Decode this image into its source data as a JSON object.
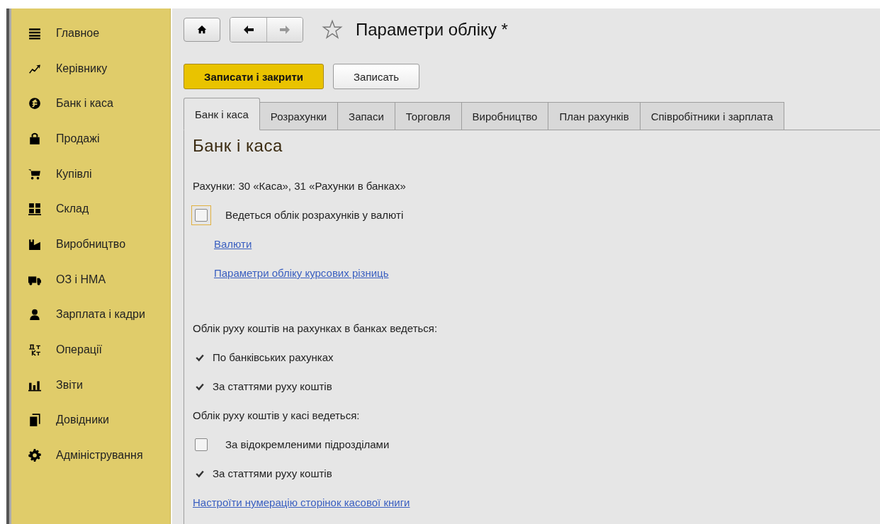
{
  "sidebar": {
    "items": [
      {
        "label": "Главное"
      },
      {
        "label": "Керівнику"
      },
      {
        "label": "Банк і каса"
      },
      {
        "label": "Продажі"
      },
      {
        "label": "Купівлі"
      },
      {
        "label": "Склад"
      },
      {
        "label": "Виробництво"
      },
      {
        "label": "ОЗ і НМА"
      },
      {
        "label": "Зарплата і кадри"
      },
      {
        "label": "Операції"
      },
      {
        "label": "Звіти"
      },
      {
        "label": "Довідники"
      },
      {
        "label": "Адміністрування"
      }
    ]
  },
  "toolbar": {
    "forward_disabled": true,
    "title": "Параметри обліку *"
  },
  "buttons": [
    {
      "label": "Записати і закрити",
      "kind": "primary"
    },
    {
      "label": "Записать",
      "kind": "default"
    }
  ],
  "tabs": [
    {
      "label": "Банк і каса",
      "selected": true
    },
    {
      "label": "Розрахунки",
      "selected": false
    },
    {
      "label": "Запаси",
      "selected": false
    },
    {
      "label": "Торговля",
      "selected": false
    },
    {
      "label": "Виробництво",
      "selected": false
    },
    {
      "label": "План рахунків",
      "selected": false
    },
    {
      "label": "Співробітники і зарплата",
      "selected": false
    }
  ],
  "section": {
    "heading": "Банк і каса",
    "rows": [
      {
        "kind": "text",
        "text": "Рахунки: 30 «Каса», 31 «Рахунки в банках»"
      },
      {
        "kind": "checkbox",
        "text": "Ведеться облік розрахунків у валюті",
        "checked": false,
        "focused": true
      },
      {
        "kind": "link",
        "text": "Валюти",
        "indent": true
      },
      {
        "kind": "link",
        "text": "Параметри обліку курсових різниць",
        "indent": true
      },
      {
        "kind": "spacer"
      },
      {
        "kind": "text",
        "text": "Облік руху коштів на рахунках в банках ведеться:"
      },
      {
        "kind": "check",
        "text": "По банківських рахунках",
        "checked": true
      },
      {
        "kind": "check",
        "text": "За статтями руху коштів",
        "checked": true
      },
      {
        "kind": "text",
        "text": "Облік руху коштів у касі ведеться:"
      },
      {
        "kind": "checkbox",
        "text": "За відокремленими підрозділами",
        "checked": false,
        "focused": false
      },
      {
        "kind": "check",
        "text": "За статтями руху коштів",
        "checked": true
      },
      {
        "kind": "link",
        "text": "Настроїти нумерацію сторінок касової книги",
        "indent": false
      }
    ]
  }
}
